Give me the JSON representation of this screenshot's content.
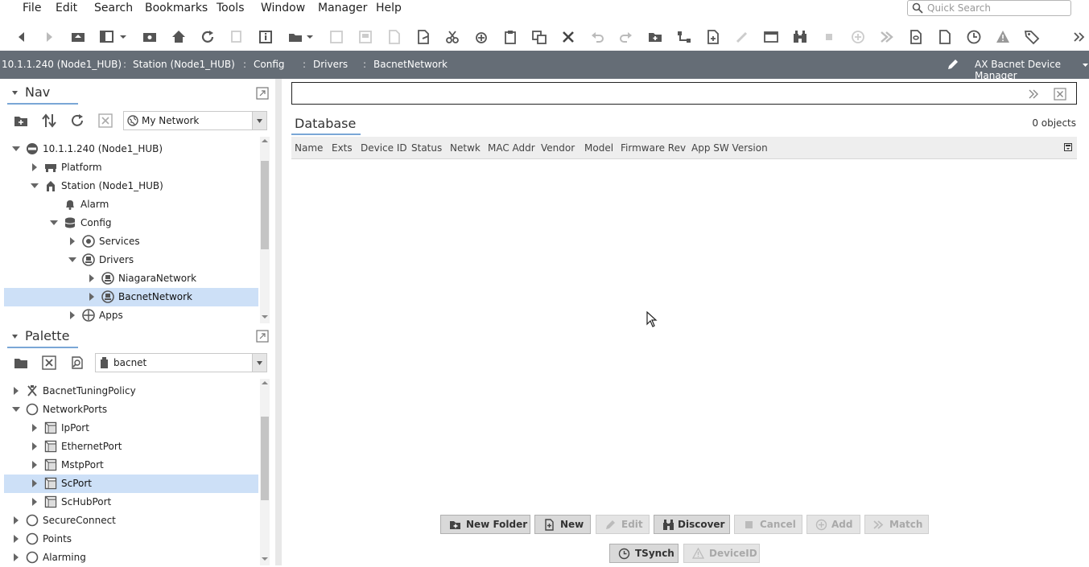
{
  "menubar": {
    "items": [
      "File",
      "Edit",
      "Search",
      "Bookmarks",
      "Tools",
      "Window",
      "Manager",
      "Help"
    ],
    "quick_search_placeholder": "Quick Search"
  },
  "pathbar": {
    "crumbs": [
      "10.1.1.240 (Node1_HUB)",
      "Station (Node1_HUB)",
      "Config",
      "Drivers",
      "BacnetNetwork"
    ],
    "view_name": "AX Bacnet Device Manager"
  },
  "nav": {
    "title": "Nav",
    "network_select": "My Network",
    "tree": [
      {
        "label": "10.1.1.240 (Node1_HUB)",
        "icon": "host-icon",
        "expanded": true
      },
      {
        "label": "Platform",
        "icon": "platform-icon",
        "expanded": false
      },
      {
        "label": "Station (Node1_HUB)",
        "icon": "station-icon",
        "expanded": true
      },
      {
        "label": "Alarm",
        "icon": "bell-icon",
        "expanded": null
      },
      {
        "label": "Config",
        "icon": "config-icon",
        "expanded": true
      },
      {
        "label": "Services",
        "icon": "services-icon",
        "expanded": false
      },
      {
        "label": "Drivers",
        "icon": "driver-icon",
        "expanded": true
      },
      {
        "label": "NiagaraNetwork",
        "icon": "network-icon",
        "expanded": false
      },
      {
        "label": "BacnetNetwork",
        "icon": "network-icon",
        "expanded": false,
        "selected": true
      },
      {
        "label": "Apps",
        "icon": "apps-icon",
        "expanded": false
      }
    ]
  },
  "palette": {
    "title": "Palette",
    "module_select": "bacnet",
    "tree": [
      {
        "label": "BacnetTuningPolicy",
        "icon": "tuning-icon",
        "expanded": false
      },
      {
        "label": "NetworkPorts",
        "icon": "folder-icon",
        "expanded": true
      },
      {
        "label": "IpPort",
        "icon": "port-icon",
        "expanded": false
      },
      {
        "label": "EthernetPort",
        "icon": "port-icon",
        "expanded": false
      },
      {
        "label": "MstpPort",
        "icon": "port-icon",
        "expanded": false
      },
      {
        "label": "ScPort",
        "icon": "port-icon",
        "expanded": false,
        "selected": true
      },
      {
        "label": "ScHubPort",
        "icon": "port-icon",
        "expanded": false
      },
      {
        "label": "SecureConnect",
        "icon": "folder-icon",
        "expanded": false
      },
      {
        "label": "Points",
        "icon": "folder-icon",
        "expanded": false
      },
      {
        "label": "Alarming",
        "icon": "folder-icon",
        "expanded": false
      }
    ]
  },
  "database": {
    "title": "Database",
    "object_count": "0 objects",
    "columns": [
      "Name",
      "Exts",
      "Device ID",
      "Status",
      "Netwk",
      "MAC Addr",
      "Vendor",
      "Model",
      "Firmware Rev",
      "App SW Version"
    ]
  },
  "buttons": {
    "new_folder": "New Folder",
    "new": "New",
    "edit": "Edit",
    "discover": "Discover",
    "cancel": "Cancel",
    "add": "Add",
    "match": "Match",
    "tsynch": "TSynch",
    "device_id": "DeviceID"
  },
  "colors": {
    "pathbar_bg": "#656d76",
    "selection": "#cde0f7",
    "tab_underline": "#7aa7d6"
  }
}
